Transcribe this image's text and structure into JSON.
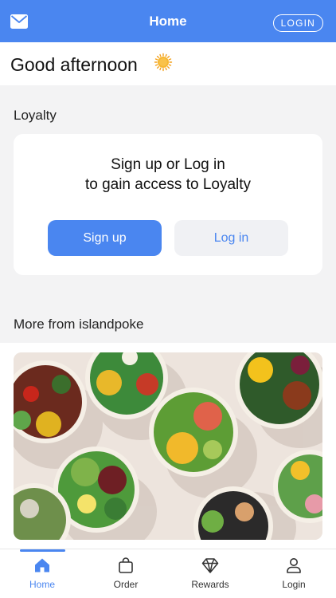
{
  "header": {
    "title": "Home",
    "login_label": "LOGIN",
    "mail_icon": "mail-icon"
  },
  "greeting": {
    "text": "Good afternoon",
    "icon": "sun-icon"
  },
  "loyalty": {
    "section_title": "Loyalty",
    "prompt_line1": "Sign up or Log in",
    "prompt_line2": "to gain access to Loyalty",
    "signup_label": "Sign up",
    "login_label": "Log in"
  },
  "more": {
    "section_title": "More from islandpoke",
    "image": "poke-bowls-photo"
  },
  "tabbar": {
    "items": [
      {
        "label": "Home",
        "icon": "home-icon",
        "active": true
      },
      {
        "label": "Order",
        "icon": "bag-icon",
        "active": false
      },
      {
        "label": "Rewards",
        "icon": "diamond-icon",
        "active": false
      },
      {
        "label": "Login",
        "icon": "user-icon",
        "active": false
      }
    ]
  },
  "colors": {
    "accent": "#4a86f0",
    "background": "#f3f3f4",
    "card": "#ffffff",
    "secondary_button": "#f0f1f4"
  }
}
